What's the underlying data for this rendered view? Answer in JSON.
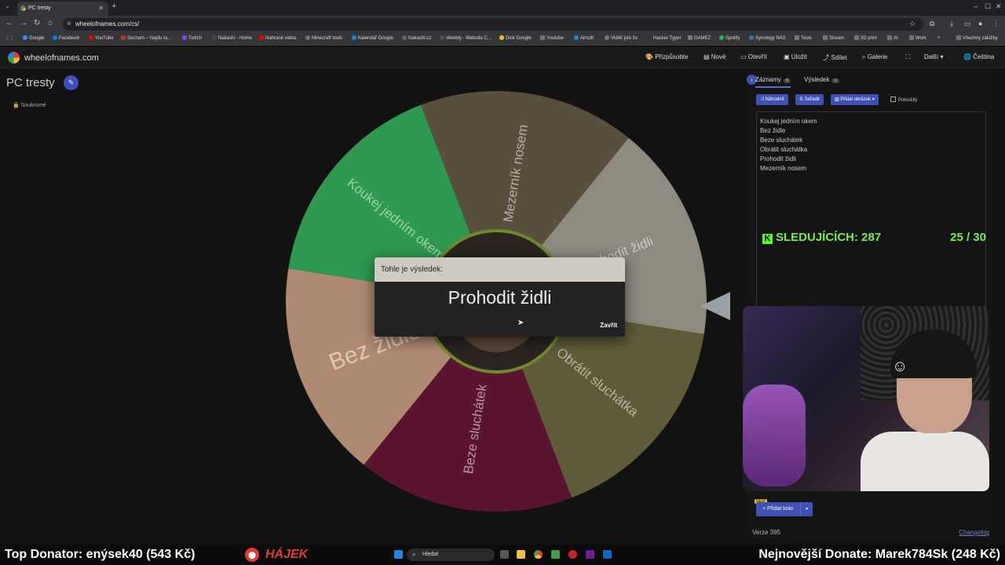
{
  "browser": {
    "tab_title": "PC tresty",
    "url": "wheelofnames.com/cs/",
    "bookmarks": [
      "Google",
      "Facebook",
      "YouTube",
      "Seznam – Najdu ta...",
      "Twitch",
      "Nakashi - Home",
      "Nahrané videa",
      "Minecraft tools",
      "Kalendář Google",
      "Nakashi.cz",
      "Weebly - Website C...",
      "Disk Google",
      "Youtube",
      "Airsoft",
      "Vidělí jste že",
      "Hacker Typer",
      "GAMEZ",
      "Spotify",
      "Synology NAS",
      "Tools",
      "Stream",
      "3D print",
      "AI",
      "Work",
      "Všechny záložky"
    ]
  },
  "app": {
    "site_name": "wheelofnames.com",
    "menu": [
      "Přizpůsobte",
      "Nové",
      "Otevřít",
      "Uložit",
      "Sdílet",
      "Galerie",
      "Další",
      "Čeština"
    ],
    "wheel_title": "PC tresty",
    "visibility": "Soukromé"
  },
  "wheel": {
    "segments": [
      {
        "label": "Mezerník nosem",
        "color": "#5a4f3c"
      },
      {
        "label": "Prohodit židli",
        "color": "#8e8a80"
      },
      {
        "label": "Obrátit sluchátka",
        "color": "#5f5a38"
      },
      {
        "label": "Beze sluchátek",
        "color": "#5b1430"
      },
      {
        "label": "Bez židle",
        "color": "#b08a70"
      },
      {
        "label": "Koukej jedním okem",
        "color": "#2e9a4f"
      }
    ]
  },
  "dialog": {
    "header": "Tohle je výsledek:",
    "result": "Prohodit židli",
    "close": "Zavřít"
  },
  "panel": {
    "tab_entries": "Záznamy",
    "tab_entries_count": "6",
    "tab_results": "Výsledek",
    "tab_results_count": "1",
    "shuffle": "Náhodně",
    "sort": "Seřadit",
    "add_image": "Přidat obrázek",
    "advanced": "Pokročilý",
    "entries": [
      "Koukej jedním okem",
      "Bez židle",
      "Beze sluchátek",
      "Obrátit sluchátka",
      "Prohodit židli",
      "Mezerník nosem"
    ],
    "add_wheel": "Přidat kolo",
    "new_badge": "NEW",
    "version": "Verze 395",
    "changelog": "Changelog"
  },
  "overlay": {
    "followers": "SLEDUJÍCÍCH: 287",
    "goal": "25 / 30",
    "top_donator": "Top Donator: enýsek40  (543 Kč)",
    "hajek": "HÁJEK",
    "latest_donate": "Nejnovější Donate: Marek784Sk (248 Kč)",
    "taskbar_search": "Hledat"
  },
  "colors": {
    "accent": "#3f51b5",
    "kick_green": "#53fc18",
    "overlay_green": "#7bea4d",
    "hajek_red": "#e53935"
  }
}
